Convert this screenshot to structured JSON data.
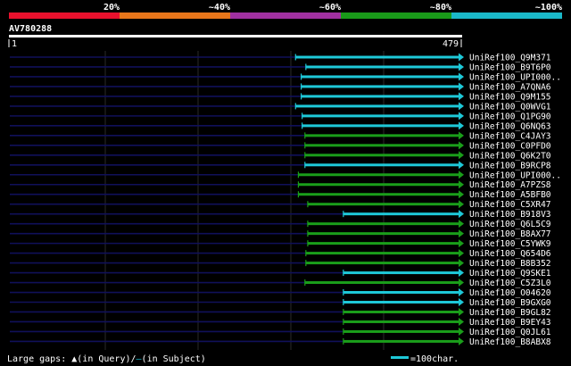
{
  "identity_scale": {
    "labels": [
      "20%",
      "~40%",
      "~60%",
      "~80%",
      "~100%"
    ],
    "colors": [
      "#e8112d",
      "#e8761a",
      "#a030a0",
      "#199a19",
      "#1ab8c8"
    ]
  },
  "query": {
    "name": "AV780288",
    "start_label": "1",
    "end_label": "479",
    "length": 479
  },
  "hits": [
    {
      "name": "UniRef100_Q9M371",
      "start": 305,
      "end": 479,
      "color": "cyan"
    },
    {
      "name": "UniRef100_B9T6P0",
      "start": 316,
      "end": 479,
      "color": "cyan"
    },
    {
      "name": "UniRef100_UPI000..",
      "start": 311,
      "end": 479,
      "color": "cyan"
    },
    {
      "name": "UniRef100_A7QNA6",
      "start": 311,
      "end": 479,
      "color": "cyan"
    },
    {
      "name": "UniRef100_Q9M155",
      "start": 311,
      "end": 479,
      "color": "cyan"
    },
    {
      "name": "UniRef100_Q0WVG1",
      "start": 305,
      "end": 479,
      "color": "cyan"
    },
    {
      "name": "UniRef100_Q1PG90",
      "start": 312,
      "end": 479,
      "color": "cyan"
    },
    {
      "name": "UniRef100_Q6NQ63",
      "start": 312,
      "end": 479,
      "color": "cyan"
    },
    {
      "name": "UniRef100_C4JAY3",
      "start": 315,
      "end": 479,
      "color": "green"
    },
    {
      "name": "UniRef100_C0PFD0",
      "start": 315,
      "end": 479,
      "color": "green"
    },
    {
      "name": "UniRef100_Q6K2T0",
      "start": 315,
      "end": 479,
      "color": "green"
    },
    {
      "name": "UniRef100_B9RCP8",
      "start": 315,
      "end": 479,
      "color": "cyan"
    },
    {
      "name": "UniRef100_UPI000..",
      "start": 308,
      "end": 479,
      "color": "green"
    },
    {
      "name": "UniRef100_A7PZS8",
      "start": 308,
      "end": 479,
      "color": "green"
    },
    {
      "name": "UniRef100_A5BFB0",
      "start": 308,
      "end": 479,
      "color": "green"
    },
    {
      "name": "UniRef100_C5XR47",
      "start": 318,
      "end": 479,
      "color": "green"
    },
    {
      "name": "UniRef100_B918V3",
      "start": 356,
      "end": 479,
      "color": "cyan"
    },
    {
      "name": "UniRef100_Q6L5C9",
      "start": 318,
      "end": 479,
      "color": "green"
    },
    {
      "name": "UniRef100_B8AX77",
      "start": 318,
      "end": 479,
      "color": "green"
    },
    {
      "name": "UniRef100_C5YWK9",
      "start": 318,
      "end": 479,
      "color": "green"
    },
    {
      "name": "UniRef100_Q654D6",
      "start": 316,
      "end": 479,
      "color": "green"
    },
    {
      "name": "UniRef100_B8B352",
      "start": 316,
      "end": 479,
      "color": "green"
    },
    {
      "name": "UniRef100_Q9SKE1",
      "start": 356,
      "end": 479,
      "color": "cyan"
    },
    {
      "name": "UniRef100_C5Z3L0",
      "start": 315,
      "end": 479,
      "color": "green"
    },
    {
      "name": "UniRef100_O04620",
      "start": 356,
      "end": 479,
      "color": "cyan"
    },
    {
      "name": "UniRef100_B9GXG0",
      "start": 356,
      "end": 479,
      "color": "cyan"
    },
    {
      "name": "UniRef100_B9GL82",
      "start": 356,
      "end": 479,
      "color": "green"
    },
    {
      "name": "UniRef100_B9EY43",
      "start": 356,
      "end": 479,
      "color": "green"
    },
    {
      "name": "UniRef100_Q0JL61",
      "start": 356,
      "end": 479,
      "color": "green"
    },
    {
      "name": "UniRef100_B8ABX8",
      "start": 356,
      "end": 479,
      "color": "green"
    }
  ],
  "colors": {
    "cyan": "#1ec8d8",
    "green": "#1a9e1a",
    "background": "#000000",
    "unaligned": "#10105a",
    "grid": "#2a2a2a"
  },
  "footer": {
    "gaps_prefix": "Large gaps: ",
    "gaps_query_mark": "▲",
    "gaps_query_text": "(in Query)/",
    "gaps_subject_mark": "‒",
    "gaps_subject_text": "(in Subject)",
    "scale_text": "=100char."
  }
}
